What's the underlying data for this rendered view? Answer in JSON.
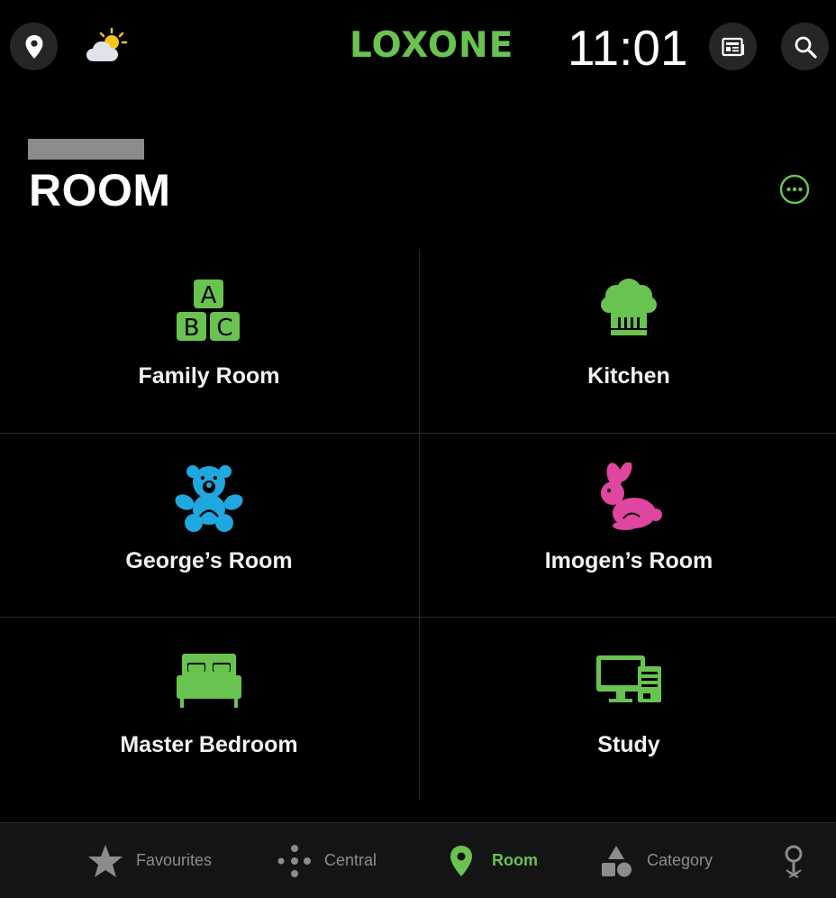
{
  "header": {
    "logo": "LOXONE",
    "time": "11:01",
    "location_icon": "location-pin-icon",
    "weather_icon": "partly-cloudy-icon",
    "news_icon": "newspaper-icon",
    "search_icon": "search-icon"
  },
  "page": {
    "title": "ROOM",
    "more_icon": "more-options-icon"
  },
  "rooms": [
    {
      "label": "Family Room",
      "icon": "abc-blocks-icon",
      "color": "#69c350"
    },
    {
      "label": "Kitchen",
      "icon": "chef-hat-icon",
      "color": "#69c350"
    },
    {
      "label": "George’s Room",
      "icon": "teddy-bear-icon",
      "color": "#1fa7df"
    },
    {
      "label": "Imogen’s Room",
      "icon": "rabbit-icon",
      "color": "#e0459f"
    },
    {
      "label": "Master Bedroom",
      "icon": "bed-icon",
      "color": "#69c350"
    },
    {
      "label": "Study",
      "icon": "computer-icon",
      "color": "#69c350"
    }
  ],
  "bottom_nav": [
    {
      "label": "Favourites",
      "icon": "star-icon",
      "active": false
    },
    {
      "label": "Central",
      "icon": "central-dots-icon",
      "active": false
    },
    {
      "label": "Room",
      "icon": "location-pin-icon",
      "active": true
    },
    {
      "label": "Category",
      "icon": "shapes-icon",
      "active": false
    },
    {
      "label": "",
      "icon": "presence-pin-icon",
      "active": false
    }
  ],
  "colors": {
    "accent": "#69c350",
    "background": "#000000",
    "tile_divider": "#2c2c2c",
    "inactive_nav": "#8c8c8c"
  }
}
